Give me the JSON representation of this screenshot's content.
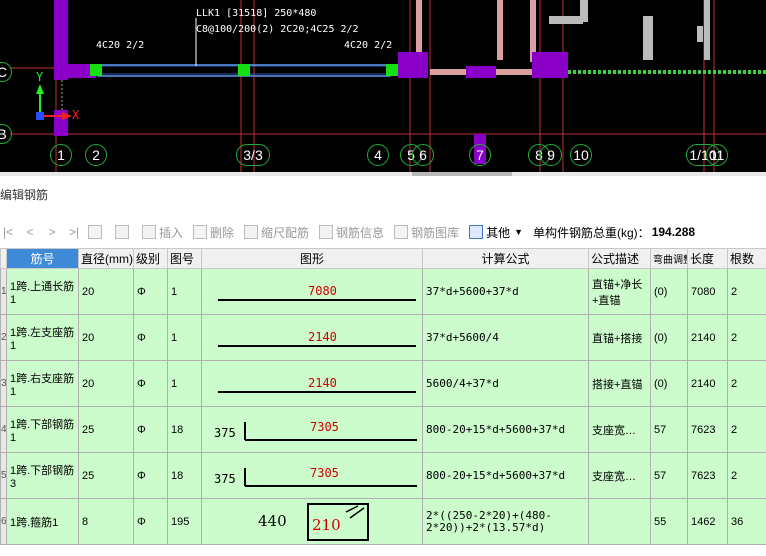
{
  "cad": {
    "beam_label_line1": "LLK1 [31518] 250*480",
    "beam_label_line2": "C8@100/200(2) 2C20;4C25 2/2",
    "left_rebar": "4C20 2/2",
    "right_rebar": "4C20 2/2",
    "axis_labels": [
      "1",
      "2",
      "3/3",
      "4",
      "5",
      "6",
      "7",
      "8",
      "9",
      "10",
      "1/10",
      "11"
    ],
    "side_labels": [
      "C",
      "B"
    ],
    "ucs_x": "X",
    "ucs_y": "Y"
  },
  "panel": {
    "title": "编辑钢筋"
  },
  "toolbar": {
    "nav": [
      "|<",
      "<",
      ">",
      ">|"
    ],
    "insert": "插入",
    "delete": "删除",
    "scale_rebar": "缩尺配筋",
    "rebar_info": "钢筋信息",
    "rebar_library": "钢筋图库",
    "other": "其他",
    "total_weight_label": "单构件钢筋总重(kg)：",
    "total_weight_value": "194.288"
  },
  "table": {
    "headers": [
      "筋号",
      "直径(mm)",
      "级别",
      "图号",
      "图形",
      "计算公式",
      "公式描述",
      "弯曲调整",
      "长度",
      "根数"
    ],
    "rows": [
      {
        "no": "1",
        "name": "1跨.上通长筋1",
        "dia": "20",
        "grade": "Φ",
        "fig": "1",
        "shape_left": "",
        "shape_val": "7080",
        "formula": "37*d+5600+37*d",
        "desc": "直锚+净长+直锚",
        "bend": "(0)",
        "len": "7080",
        "count": "2"
      },
      {
        "no": "2",
        "name": "1跨.左支座筋1",
        "dia": "20",
        "grade": "Φ",
        "fig": "1",
        "shape_left": "",
        "shape_val": "2140",
        "formula": "37*d+5600/4",
        "desc": "直锚+搭接",
        "bend": "(0)",
        "len": "2140",
        "count": "2"
      },
      {
        "no": "3",
        "name": "1跨.右支座筋1",
        "dia": "20",
        "grade": "Φ",
        "fig": "1",
        "shape_left": "",
        "shape_val": "2140",
        "formula": "5600/4+37*d",
        "desc": "搭接+直锚",
        "bend": "(0)",
        "len": "2140",
        "count": "2"
      },
      {
        "no": "4",
        "name": "1跨.下部钢筋1",
        "dia": "25",
        "grade": "Φ",
        "fig": "18",
        "shape_left": "375",
        "shape_val": "7305",
        "formula": "800-20+15*d+5600+37*d",
        "desc": "支座宽…",
        "bend": "57",
        "len": "7623",
        "count": "2"
      },
      {
        "no": "5",
        "name": "1跨.下部钢筋3",
        "dia": "25",
        "grade": "Φ",
        "fig": "18",
        "shape_left": "375",
        "shape_val": "7305",
        "formula": "800-20+15*d+5600+37*d",
        "desc": "支座宽…",
        "bend": "57",
        "len": "7623",
        "count": "2"
      },
      {
        "no": "6",
        "name": "1跨.箍筋1",
        "dia": "8",
        "grade": "Φ",
        "fig": "195",
        "shape_left": "440",
        "shape_val": "210",
        "formula": "2*((250-2*20)+(480-2*20))+2*(13.57*d)",
        "desc": "",
        "bend": "55",
        "len": "1462",
        "count": "36"
      }
    ]
  }
}
